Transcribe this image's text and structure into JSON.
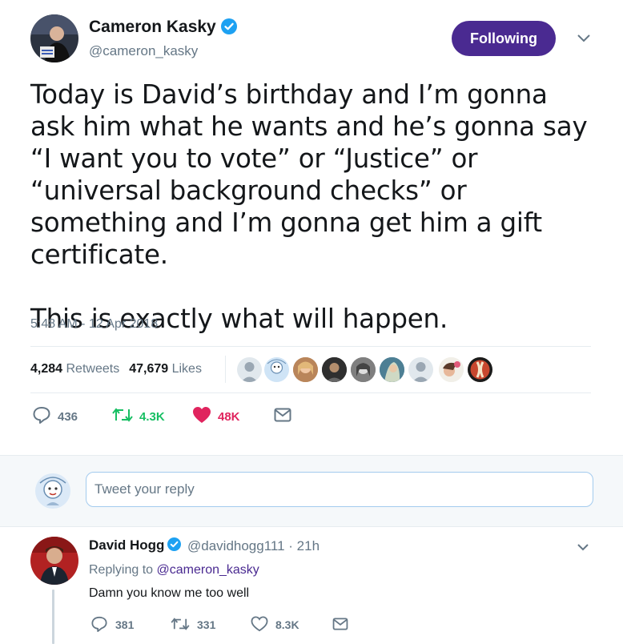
{
  "author": {
    "name": "Cameron Kasky",
    "handle": "@cameron_kasky",
    "follow_label": "Following"
  },
  "tweet": {
    "paragraph1": "Today is David’s birthday and I’m gonna ask him what he wants and he’s gonna say “I want you to vote” or “Justice” or “universal background checks” or something and I’m gonna get him a gift certificate.",
    "paragraph2": "This is exactly what will happen.",
    "timestamp": "5:48 AM - 12 Apr 2018",
    "retweets_count": "4,284",
    "retweets_label": "Retweets",
    "likes_count": "47,679",
    "likes_label": "Likes",
    "actions": {
      "replies": "436",
      "retweets": "4.3K",
      "likes": "48K"
    }
  },
  "reply_box": {
    "placeholder": "Tweet your reply"
  },
  "reply": {
    "name": "David Hogg",
    "handle_time": "@davidhogg111 · 21h",
    "replying_prefix": "Replying to",
    "replying_to": "@cameron_kasky",
    "text": "Damn you know me too well",
    "actions": {
      "replies": "381",
      "retweets": "331",
      "likes": "8.3K"
    }
  },
  "colors": {
    "accent": "#4a2a91",
    "retweet_green": "#17bf63",
    "like_red": "#e0245e",
    "verified_blue": "#1da1f2",
    "muted": "#657786"
  },
  "icons": [
    "verified-icon",
    "chevron-down-icon",
    "reply-icon",
    "retweet-icon",
    "heart-icon",
    "mail-icon"
  ]
}
